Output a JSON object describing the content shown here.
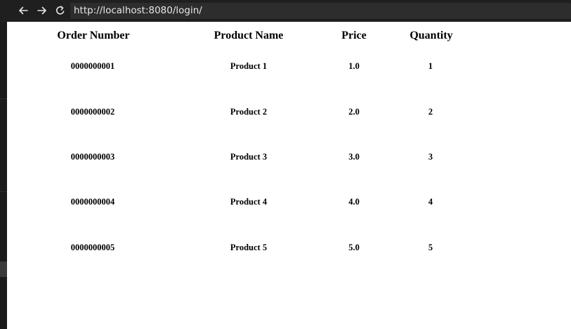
{
  "browser": {
    "back_icon": "arrow-left-icon",
    "forward_icon": "arrow-right-icon",
    "reload_icon": "reload-icon",
    "url": "http://localhost:8080/login/"
  },
  "table": {
    "headers": [
      "Order Number",
      "Product Name",
      "Price",
      "Quantity"
    ],
    "rows": [
      {
        "order_number": "0000000001",
        "product_name": "Product 1",
        "price": "1.0",
        "quantity": "1"
      },
      {
        "order_number": "0000000002",
        "product_name": "Product 2",
        "price": "2.0",
        "quantity": "2"
      },
      {
        "order_number": "0000000003",
        "product_name": "Product 3",
        "price": "3.0",
        "quantity": "3"
      },
      {
        "order_number": "0000000004",
        "product_name": "Product 4",
        "price": "4.0",
        "quantity": "4"
      },
      {
        "order_number": "0000000005",
        "product_name": "Product 5",
        "price": "5.0",
        "quantity": "5"
      }
    ]
  }
}
